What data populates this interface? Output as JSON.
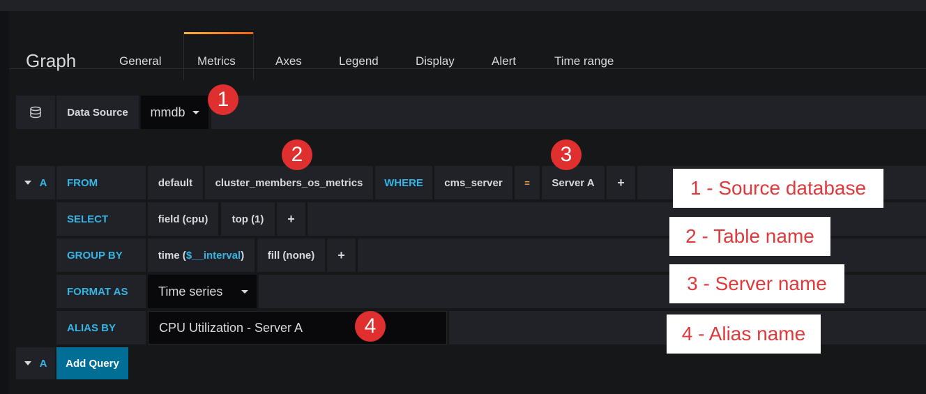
{
  "panel": {
    "title": "Graph",
    "tabs": [
      {
        "label": "General"
      },
      {
        "label": "Metrics"
      },
      {
        "label": "Axes"
      },
      {
        "label": "Legend"
      },
      {
        "label": "Display"
      },
      {
        "label": "Alert"
      },
      {
        "label": "Time range"
      }
    ],
    "active_tab": "Metrics"
  },
  "datasource": {
    "label": "Data Source",
    "value": "mmdb",
    "icon": "database-icon"
  },
  "query": {
    "ref_id": "A",
    "from": {
      "keyword": "FROM",
      "policy": "default",
      "measurement": "cluster_members_os_metrics",
      "where_keyword": "WHERE",
      "tag_key": "cms_server",
      "operator": "=",
      "tag_value": "Server A",
      "add": "+"
    },
    "select": {
      "keyword": "SELECT",
      "field": "field (cpu)",
      "selector": "top (1)",
      "add": "+"
    },
    "group_by": {
      "keyword": "GROUP BY",
      "time_prefix": "time (",
      "time_var": "$__interval",
      "time_suffix": ")",
      "fill": "fill (none)",
      "add": "+"
    },
    "format_as": {
      "keyword": "FORMAT AS",
      "value": "Time series"
    },
    "alias_by": {
      "keyword": "ALIAS BY",
      "value": "CPU Utilization -  Server A"
    }
  },
  "add_query": {
    "ref_id": "A",
    "label": "Add Query"
  },
  "annotations": {
    "callouts": [
      "1",
      "2",
      "3",
      "4"
    ],
    "notes": [
      "1 - Source database",
      "2 - Table name",
      "3 - Server name",
      "4 - Alias name"
    ]
  },
  "colors": {
    "keyword": "#33b5e5",
    "callout": "#e02f2f",
    "note_text": "#e0393b",
    "active_tab_gradient": [
      "#fbb040",
      "#f2620f"
    ],
    "add_query_button": "#006e95"
  }
}
